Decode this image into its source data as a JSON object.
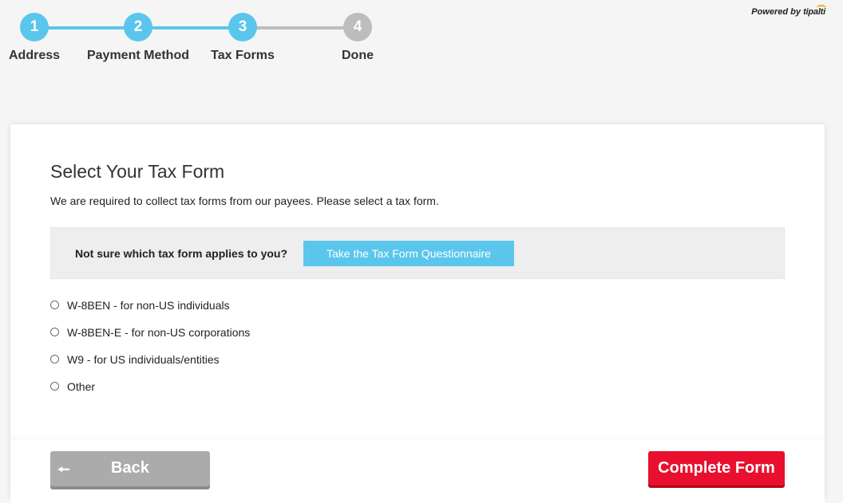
{
  "stepper": {
    "steps": [
      {
        "number": "1",
        "label": "Address",
        "status": "complete"
      },
      {
        "number": "2",
        "label": "Payment Method",
        "status": "complete"
      },
      {
        "number": "3",
        "label": "Tax Forms",
        "status": "current"
      },
      {
        "number": "4",
        "label": "Done",
        "status": "pending"
      }
    ]
  },
  "branding": {
    "powered_by": "Powered by",
    "brand_name": "tipalti"
  },
  "form": {
    "title": "Select Your Tax Form",
    "description": "We are required to collect tax forms from our payees. Please select a tax form.",
    "questionnaire": {
      "prompt": "Not sure which tax form applies to you?",
      "button_label": "Take the Tax Form Questionnaire"
    },
    "options": [
      {
        "label": "W-8BEN - for non-US individuals",
        "selected": false
      },
      {
        "label": "W-8BEN-E - for non-US corporations",
        "selected": false
      },
      {
        "label": "W9 - for US individuals/entities",
        "selected": false
      },
      {
        "label": "Other",
        "selected": false
      }
    ]
  },
  "footer": {
    "back_label": "Back",
    "back_icon": "arrow-left-icon",
    "complete_label": "Complete Form"
  },
  "colors": {
    "accent": "#5bc6ec",
    "inactive": "#bdbdbd",
    "primary_action": "#e8102e",
    "secondary_action": "#ababab"
  }
}
